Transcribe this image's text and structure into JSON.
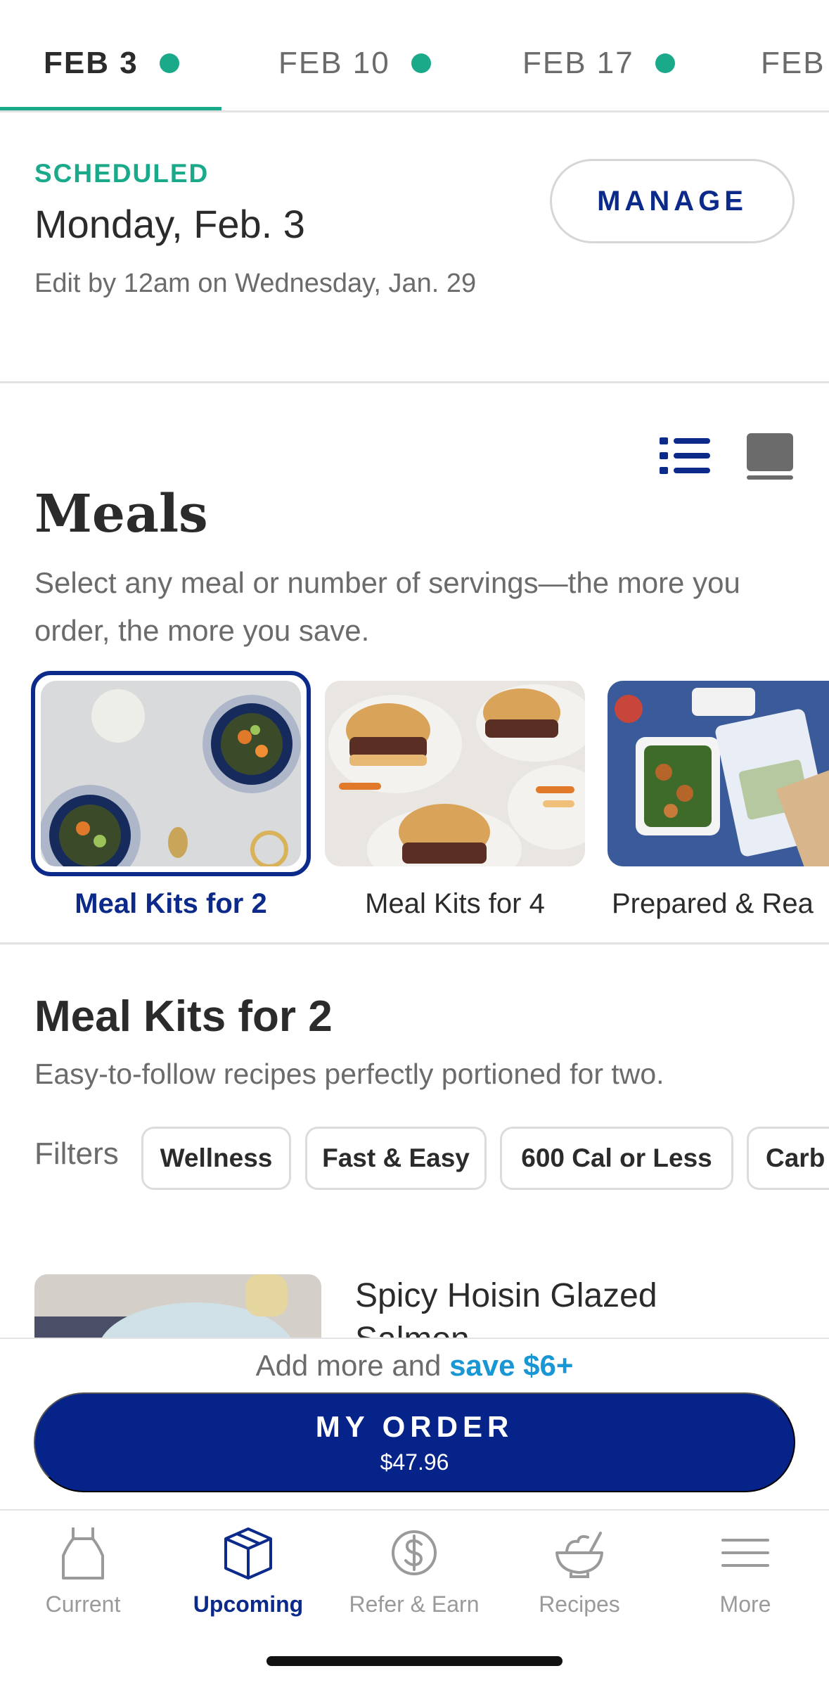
{
  "weeks": [
    {
      "label": "FEB 3",
      "dot": true,
      "active": true
    },
    {
      "label": "FEB 10",
      "dot": true,
      "active": false
    },
    {
      "label": "FEB 17",
      "dot": true,
      "active": false
    },
    {
      "label": "FEB",
      "dot": false,
      "active": false
    }
  ],
  "schedule": {
    "status": "SCHEDULED",
    "date": "Monday, Feb. 3",
    "edit_by": "Edit by 12am on Wednesday, Jan. 29",
    "manage_label": "MANAGE"
  },
  "meals": {
    "title": "Meals",
    "subtitle": "Select any meal or number of servings—the more you order, the more you save.",
    "categories": [
      {
        "label": "Meal Kits for 2",
        "selected": true
      },
      {
        "label": "Meal Kits for 4",
        "selected": false
      },
      {
        "label": "Prepared & Rea",
        "selected": false
      }
    ]
  },
  "section": {
    "title": "Meal Kits for 2",
    "subtitle": "Easy-to-follow recipes perfectly portioned for two.",
    "filters_label": "Filters",
    "filters": [
      "Wellness",
      "Fast & Easy",
      "600 Cal or Less",
      "Carb"
    ]
  },
  "first_meal": {
    "name": "Spicy Hoisin Glazed Salmon"
  },
  "order": {
    "promo_prefix": "Add more and",
    "promo_save": "save $6+",
    "button_label": "MY ORDER",
    "total": "$47.96"
  },
  "nav": [
    {
      "label": "Current",
      "icon": "apron-icon",
      "active": false
    },
    {
      "label": "Upcoming",
      "icon": "box-icon",
      "active": true
    },
    {
      "label": "Refer & Earn",
      "icon": "dollar-icon",
      "active": false
    },
    {
      "label": "Recipes",
      "icon": "bowl-icon",
      "active": false
    },
    {
      "label": "More",
      "icon": "menu-icon",
      "active": false
    }
  ],
  "colors": {
    "accent_green": "#1aaa8a",
    "brand_blue": "#06238a",
    "save_blue": "#1996d4"
  }
}
